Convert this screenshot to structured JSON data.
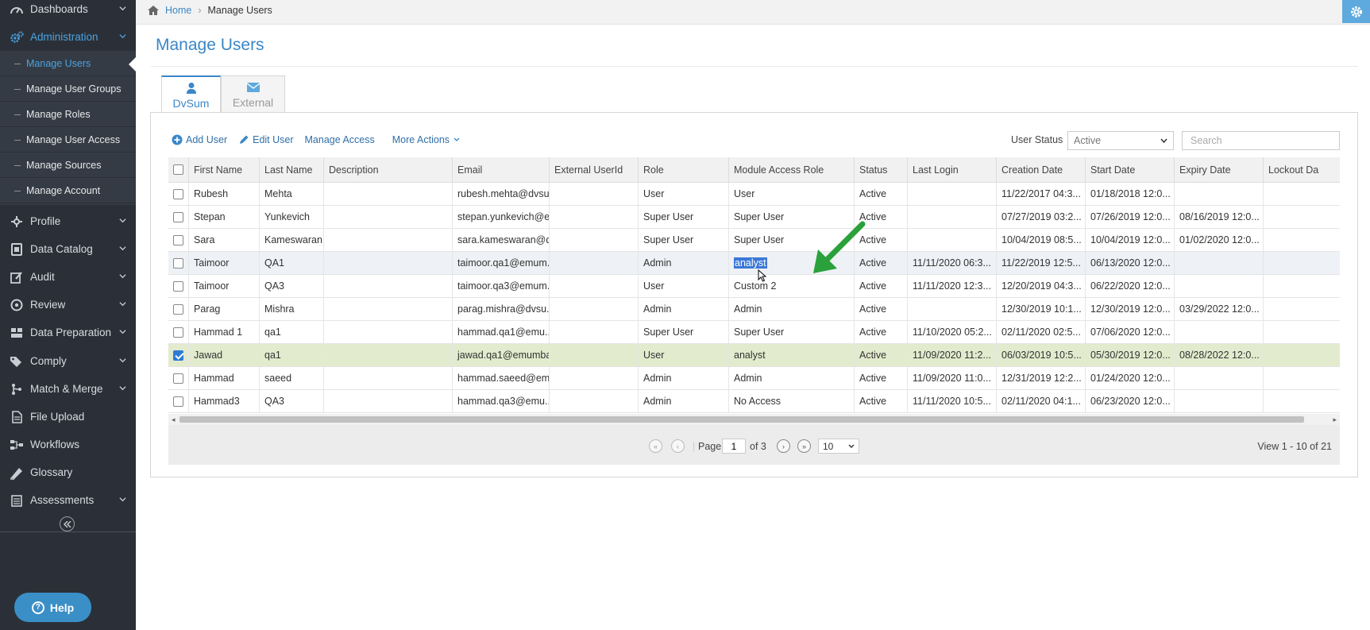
{
  "sidebar": {
    "items": [
      {
        "label": "Dashboards",
        "icon": "dashboard-icon",
        "chevron": true
      },
      {
        "label": "Administration",
        "icon": "cogs-icon",
        "chevron": true,
        "active": true
      },
      {
        "label": "Profile",
        "icon": "profile-icon",
        "chevron": true
      },
      {
        "label": "Data Catalog",
        "icon": "database-icon",
        "chevron": true
      },
      {
        "label": "Audit",
        "icon": "edit-icon",
        "chevron": true
      },
      {
        "label": "Review",
        "icon": "compass-icon",
        "chevron": true
      },
      {
        "label": "Data Preparation",
        "icon": "stack-icon",
        "chevron": true
      },
      {
        "label": "Comply",
        "icon": "tags-icon",
        "chevron": true
      },
      {
        "label": "Match & Merge",
        "icon": "merge-icon",
        "chevron": true
      },
      {
        "label": "File Upload",
        "icon": "file-icon",
        "chevron": false
      },
      {
        "label": "Workflows",
        "icon": "workflow-icon",
        "chevron": false
      },
      {
        "label": "Glossary",
        "icon": "book-icon",
        "chevron": false
      },
      {
        "label": "Assessments",
        "icon": "clipboard-icon",
        "chevron": true
      }
    ],
    "submenu": [
      {
        "label": "Manage Users",
        "active": true
      },
      {
        "label": "Manage User Groups"
      },
      {
        "label": "Manage Roles"
      },
      {
        "label": "Manage User Access"
      },
      {
        "label": "Manage Sources"
      },
      {
        "label": "Manage Account"
      }
    ],
    "help_label": "Help"
  },
  "breadcrumb": {
    "home": "Home",
    "current": "Manage Users"
  },
  "page_title": "Manage Users",
  "tabs": [
    {
      "label": "DvSum",
      "icon": "user-icon",
      "active": true
    },
    {
      "label": "External",
      "icon": "envelope-icon",
      "active": false
    }
  ],
  "toolbar": {
    "add_user": "Add User",
    "edit_user": "Edit User",
    "manage_access": "Manage Access",
    "more_actions": "More Actions",
    "user_status_label": "User Status",
    "user_status_value": "Active",
    "search_placeholder": "Search"
  },
  "grid": {
    "columns": [
      "First Name",
      "Last Name",
      "Description",
      "Email",
      "External UserId",
      "Role",
      "Module Access Role",
      "Status",
      "Last Login",
      "Creation Date",
      "Start Date",
      "Expiry Date",
      "Lockout Da"
    ],
    "rows": [
      {
        "checked": false,
        "cells": [
          "Rubesh",
          "Mehta",
          "",
          "rubesh.mehta@dvsu...",
          "",
          "User",
          "User",
          "Active",
          "",
          "11/22/2017 04:3...",
          "01/18/2018 12:0...",
          "",
          ""
        ]
      },
      {
        "checked": false,
        "cells": [
          "Stepan",
          "Yunkevich",
          "",
          "stepan.yunkevich@e...",
          "",
          "Super User",
          "Super User",
          "Active",
          "",
          "07/27/2019 03:2...",
          "07/26/2019 12:0...",
          "08/16/2019 12:0...",
          ""
        ]
      },
      {
        "checked": false,
        "cells": [
          "Sara",
          "Kameswaran",
          "",
          "sara.kameswaran@d...",
          "",
          "Super User",
          "Super User",
          "Active",
          "",
          "10/04/2019 08:5...",
          "10/04/2019 12:0...",
          "01/02/2020 12:0...",
          ""
        ]
      },
      {
        "checked": false,
        "highlight": true,
        "cells": [
          "Taimoor",
          "QA1",
          "",
          "taimoor.qa1@emum...",
          "",
          "Admin",
          "analyst",
          "Active",
          "11/11/2020 06:3...",
          "11/22/2019 12:5...",
          "06/13/2020 12:0...",
          "",
          ""
        ]
      },
      {
        "checked": false,
        "cells": [
          "Taimoor",
          "QA3",
          "",
          "taimoor.qa3@emum...",
          "",
          "User",
          "Custom 2",
          "Active",
          "11/11/2020 12:3...",
          "12/20/2019 04:3...",
          "06/22/2020 12:0...",
          "",
          ""
        ]
      },
      {
        "checked": false,
        "cells": [
          "Parag",
          "Mishra",
          "",
          "parag.mishra@dvsu...",
          "",
          "Admin",
          "Admin",
          "Active",
          "",
          "12/30/2019 10:1...",
          "12/30/2019 12:0...",
          "03/29/2022 12:0...",
          ""
        ]
      },
      {
        "checked": false,
        "cells": [
          "Hammad 1",
          "qa1",
          "",
          "hammad.qa1@emu...",
          "",
          "Super User",
          "Super User",
          "Active",
          "11/10/2020 05:2...",
          "02/11/2020 02:5...",
          "07/06/2020 12:0...",
          "",
          ""
        ]
      },
      {
        "checked": true,
        "selected": true,
        "cells": [
          "Jawad",
          "qa1",
          "",
          "jawad.qa1@emumba...",
          "",
          "User",
          "analyst",
          "Active",
          "11/09/2020 11:2...",
          "06/03/2019 10:5...",
          "05/30/2019 12:0...",
          "08/28/2022 12:0...",
          ""
        ]
      },
      {
        "checked": false,
        "cells": [
          "Hammad",
          "saeed",
          "",
          "hammad.saeed@em...",
          "",
          "Admin",
          "Admin",
          "Active",
          "11/09/2020 11:0...",
          "12/31/2019 12:2...",
          "01/24/2020 12:0...",
          "",
          ""
        ]
      },
      {
        "checked": false,
        "cells": [
          "Hammad3",
          "QA3",
          "",
          "hammad.qa3@emu...",
          "",
          "Admin",
          "No Access",
          "Active",
          "11/11/2020 10:5...",
          "02/11/2020 04:1...",
          "06/23/2020 12:0...",
          "",
          ""
        ]
      }
    ]
  },
  "pager": {
    "page_label": "Page",
    "page_value": "1",
    "of_label": "of 3",
    "page_size": "10",
    "view_info": "View 1 - 10 of 21"
  },
  "colors": {
    "accent": "#3a87c8",
    "sidebar_bg": "#2b3038",
    "selected_row": "#e2ebcd",
    "arrow": "#2aa13a"
  }
}
